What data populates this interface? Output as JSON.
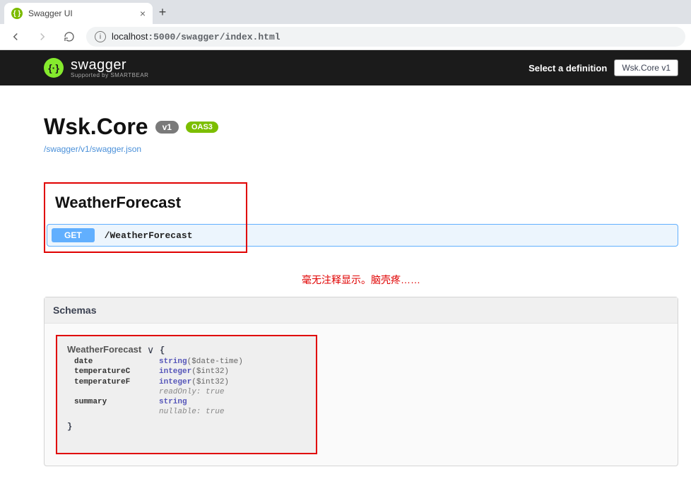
{
  "browser": {
    "tab_title": "Swagger UI",
    "url_host": "localhost",
    "url_port": ":5000",
    "url_path": "/swagger/index.html"
  },
  "topbar": {
    "brand": "swagger",
    "brand_sub": "Supported by SMARTBEAR",
    "select_label": "Select a definition",
    "select_value": "Wsk.Core v1"
  },
  "api": {
    "title": "Wsk.Core",
    "version_badge": "v1",
    "oas_badge": "OAS3",
    "spec_link": "/swagger/v1/swagger.json"
  },
  "tag": {
    "name": "WeatherForecast"
  },
  "operation": {
    "method": "GET",
    "path": "/WeatherForecast"
  },
  "annotation": "毫无注释显示。脑壳疼……",
  "schemas": {
    "section_title": "Schemas",
    "model_name": "WeatherForecast",
    "brace_open": "{",
    "brace_close": "}",
    "props": {
      "date_key": "date",
      "date_type": "string",
      "date_fmt": "($date-time)",
      "tc_key": "temperatureC",
      "tc_type": "integer",
      "tc_fmt": "($int32)",
      "tf_key": "temperatureF",
      "tf_type": "integer",
      "tf_fmt": "($int32)",
      "tf_meta": "readOnly: true",
      "sum_key": "summary",
      "sum_type": "string",
      "sum_meta": "nullable: true"
    }
  }
}
